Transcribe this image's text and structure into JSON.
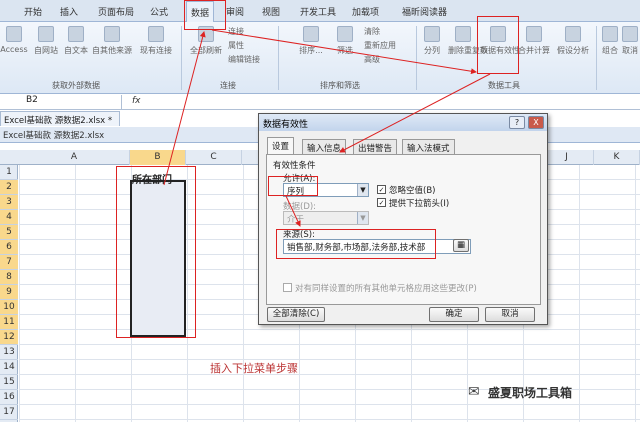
{
  "ribbon_tabs": [
    "开始",
    "插入",
    "页面布局",
    "公式",
    "数据",
    "审阅",
    "视图",
    "开发工具",
    "加载项",
    "福昕阅读器"
  ],
  "ribbon": {
    "buttons": [
      "Access",
      "自网站",
      "自文本",
      "自其他来源",
      "现有连接",
      "全部刷新",
      "排序...",
      "筛选",
      "分列",
      "删除重复项",
      "数据有效性",
      "合并计算",
      "假设分析",
      "组合",
      "取消"
    ],
    "small": [
      "连接",
      "属性",
      "编辑链接",
      "清除",
      "重新应用",
      "高级"
    ],
    "groups": [
      "获取外部数据",
      "连接",
      "排序和筛选",
      "数据工具"
    ]
  },
  "name_box": "B2",
  "fx": "fx",
  "doc_tab": "Excel基础款 源数据2.xlsx *",
  "workbook_title": "Excel基础款 源数据2.xlsx",
  "columns": [
    "A",
    "B",
    "C",
    "J",
    "K"
  ],
  "rows": [
    "1",
    "2",
    "3",
    "4",
    "5",
    "6",
    "7",
    "8",
    "9",
    "10",
    "11",
    "12",
    "13",
    "14",
    "15",
    "16",
    "17"
  ],
  "cell_b1": "所在部门",
  "dialog": {
    "title": "数据有效性",
    "tabs": [
      "设置",
      "输入信息",
      "出错警告",
      "输入法模式"
    ],
    "criteria_label": "有效性条件",
    "allow_label": "允许(A):",
    "allow_value": "序列",
    "ignore_blank": "忽略空值(B)",
    "dropdown": "提供下拉箭头(I)",
    "data_label": "数据(D):",
    "data_value": "介于",
    "source_label": "来源(S):",
    "source_value": "销售部,财务部,市场部,法务部,技术部",
    "apply_all": "对有同样设置的所有其他单元格应用这些更改(P)",
    "clear_all": "全部清除(C)",
    "ok": "确定",
    "cancel": "取消",
    "help": "?",
    "close": "X"
  },
  "caption": "插入下拉菜单步骤",
  "watermark": "盛夏职场工具箱",
  "colors": {
    "annotation": "#dd2222",
    "selected_header": "#f9d88c"
  }
}
